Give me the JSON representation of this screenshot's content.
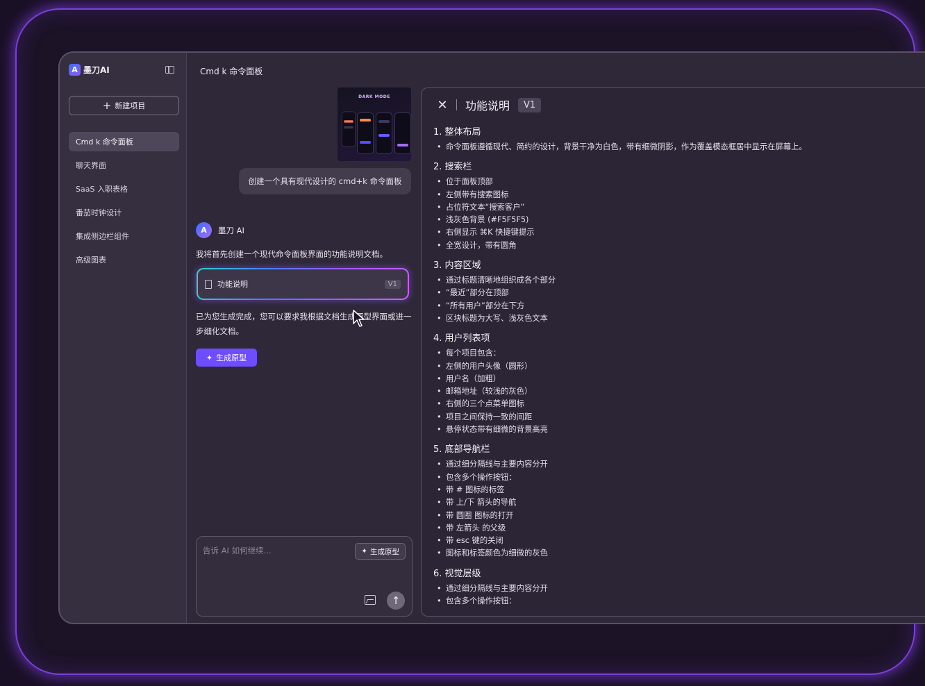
{
  "sidebar": {
    "logo_mark": "A",
    "app_name": "墨刀AI",
    "new_project": "新建项目",
    "items": [
      {
        "label": "Cmd k 命令面板",
        "active": true
      },
      {
        "label": "聊天界面",
        "active": false
      },
      {
        "label": "SaaS 入职表格",
        "active": false
      },
      {
        "label": "番茄时钟设计",
        "active": false
      },
      {
        "label": "集成侧边栏组件",
        "active": false
      },
      {
        "label": "高级图表",
        "active": false
      }
    ]
  },
  "chat": {
    "title": "Cmd k 命令面板",
    "thumbnail_label": "DARK MODE",
    "user_message": "创建一个具有现代设计的 cmd+k 命令面板",
    "ai_name": "墨刀 AI",
    "ai_message_1": "我将首先创建一个现代命令面板界面的功能说明文档。",
    "doc_card": {
      "label": "功能说明",
      "version": "V1"
    },
    "ai_message_2": "已为您生成完成，您可以要求我根据文档生成原型界面或进一步细化文档。",
    "generate_button": "生成原型",
    "input": {
      "placeholder": "告诉 AI 如何继续...",
      "generate_button": "生成原型"
    }
  },
  "doc_panel": {
    "title": "功能说明",
    "version": "V1",
    "sections": [
      {
        "heading": "1. 整体布局",
        "items": [
          "命令面板遵循现代、简约的设计，背景干净为白色，带有细微阴影，作为覆盖模态框居中显示在屏幕上。"
        ]
      },
      {
        "heading": "2. 搜索栏",
        "items": [
          "位于面板顶部",
          "左侧带有搜索图标",
          "占位符文本“搜索客户”",
          "浅灰色背景 (#F5F5F5)",
          "右侧显示 ⌘K 快捷键提示",
          "全宽设计，带有圆角"
        ]
      },
      {
        "heading": "3. 内容区域",
        "items": [
          "通过标题清晰地组织成各个部分",
          "“最近”部分在顶部",
          "“所有用户”部分在下方",
          "区块标题为大写、浅灰色文本"
        ]
      },
      {
        "heading": "4. 用户列表项",
        "items": [
          "每个项目包含：",
          "左侧的用户头像（圆形）",
          "用户名（加粗）",
          "邮箱地址（较浅的灰色）",
          "右侧的三个点菜单图标",
          "项目之间保持一致的间距",
          "悬停状态带有细微的背景高亮"
        ]
      },
      {
        "heading": "5. 底部导航栏",
        "items": [
          "通过细分隔线与主要内容分开",
          "包含多个操作按钮：",
          "带 # 图标的标签",
          "带 上/下 箭头的导航",
          "带 圆圈 图标的打开",
          "带 左箭头 的父级",
          "带 esc 键的关闭",
          "图标和标签颜色为细微的灰色"
        ]
      },
      {
        "heading": "6. 视觉层级",
        "items": [
          "通过细分隔线与主要内容分开",
          "包含多个操作按钮："
        ]
      }
    ]
  }
}
